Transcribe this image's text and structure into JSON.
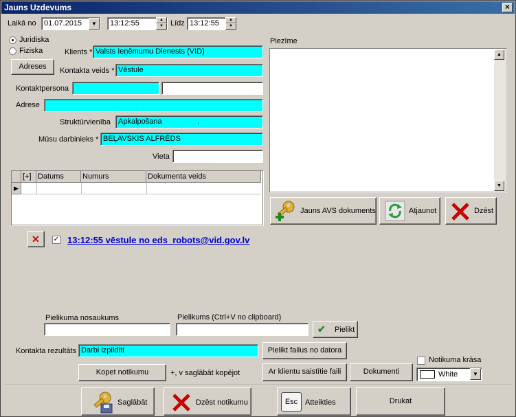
{
  "window": {
    "title": "Jauns Uzdevums",
    "close": "×"
  },
  "period": {
    "from_label": "Laikā no",
    "date": "01.07.2015",
    "time_from": "13:12:55",
    "to_label": "Līdz",
    "time_to": "13:12:55"
  },
  "client_type": {
    "options": [
      "Juridiska",
      "Fiziska"
    ],
    "selected": "Juridiska"
  },
  "labels": {
    "client": "Klients *",
    "contact_type": "Kontakta veids *",
    "contact_person": "Kontaktpersona",
    "address": "Adrese",
    "structural_unit": "Struktūrvienība",
    "our_employee": "Mūsu darbinieks *",
    "place": "Vieta",
    "note": "Piezīme"
  },
  "values": {
    "client": "Valsts Ieņēmumu Dienests (VID)",
    "contact_type": "Vēstule",
    "contact_person": "",
    "contact_person_extra": "",
    "address": "",
    "structural_unit": "Apkalpošana",
    "structural_unit_dots": ".",
    "our_employee": "BEĻAVSKIS ALFRĒDS",
    "place": ""
  },
  "buttons": {
    "addresses": "Adreses",
    "new_doc": "Jauns AVS dokuments",
    "refresh": "Atjaunot",
    "delete": "Dzēst",
    "attach": "Pielikt",
    "attach_files": "Pielikt failus no datora",
    "copy_event": "Kopet notikumu",
    "client_files": "Ar klientu saistītie faili",
    "documents": "Dokumenti",
    "save": "Saglābāt",
    "delete_event": "Dzēst notikumu",
    "cancel": "Atteikties",
    "print": "Drukat",
    "esc_key": "Esc",
    "remove_icon": "✕",
    "check_mark": "✔"
  },
  "grid": {
    "columns": [
      "[+]",
      "Datums",
      "Numurs",
      "Dokumenta veids"
    ],
    "row_marker": "▶"
  },
  "scroll": {
    "up": "▲",
    "down": "▼"
  },
  "combo": {
    "arrow": "▼"
  },
  "spin": {
    "up": "▲",
    "down": "▼"
  },
  "attachment_link": {
    "checked": true,
    "check": "✓",
    "text": "13:12:55 vēstule no eds_robots@vid.gov.lv"
  },
  "attachment": {
    "name_label": "Pielikuma nosaukums",
    "name": "",
    "clipboard_label": "Pielikums (Ctrl+V no clipboard)",
    "clipboard": ""
  },
  "result": {
    "label": "Kontakta rezultāts",
    "value": "Darbi izpildīti"
  },
  "copy_hint": "+, v saglābāt kopējot",
  "event_color": {
    "label": "Notikuma krāsa",
    "checked": false,
    "value": "White",
    "swatch": "#ffffff"
  },
  "colors": {
    "title_start": "#0a246a",
    "title_end": "#3a6ea5",
    "required_field": "#00ffff",
    "link": "#0000cc",
    "delete_red": "#cc0000",
    "ok_green": "#1a8a1a"
  }
}
